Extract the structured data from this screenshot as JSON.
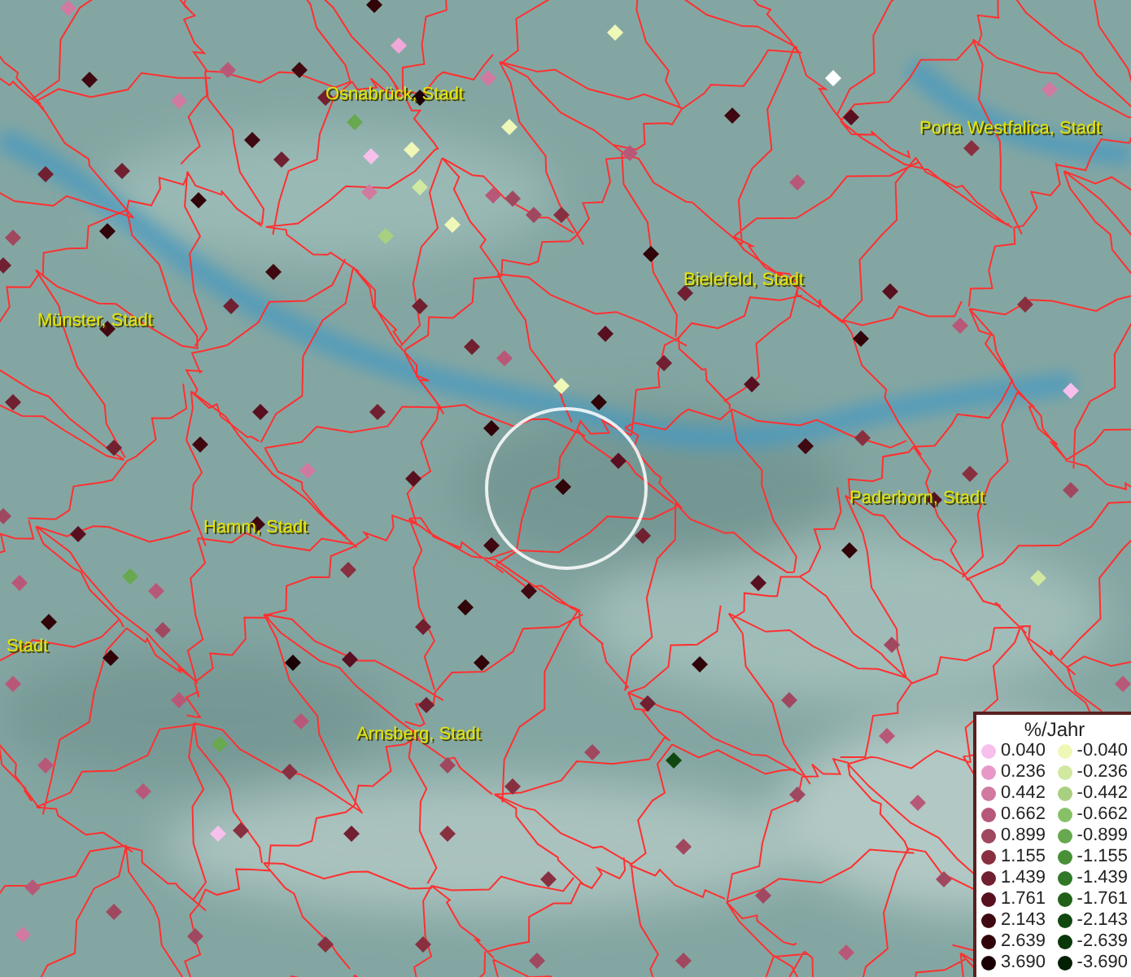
{
  "map": {
    "cities": [
      {
        "name": "Osnabrück, Stadt"
      },
      {
        "name": "Porta Westfalica, Stadt"
      },
      {
        "name": "Bielefeld, Stadt"
      },
      {
        "name": "Münster, Stadt"
      },
      {
        "name": "Paderborn, Stadt"
      },
      {
        "name": "Hamm, Stadt"
      },
      {
        "name": "Stadt"
      },
      {
        "name": "Arnsberg, Stadt"
      }
    ],
    "markers": [
      {
        "color": "#d07aa0"
      },
      {
        "color": "#300408"
      },
      {
        "color": "#f0f8b8"
      },
      {
        "color": "#f0a8d8"
      },
      {
        "color": "#ffffff"
      },
      {
        "color": "#400810"
      },
      {
        "color": "#b85878"
      },
      {
        "color": "#400810"
      },
      {
        "color": "#d07aa0"
      },
      {
        "color": "#d07aa0"
      },
      {
        "color": "#702030"
      },
      {
        "color": "#1a0004"
      },
      {
        "color": "#68a850"
      },
      {
        "color": "#f0f8b8"
      },
      {
        "color": "#400810"
      },
      {
        "color": "#f7c0ec"
      },
      {
        "color": "#f0f8b8"
      },
      {
        "color": "#702030"
      },
      {
        "color": "#b85878"
      },
      {
        "color": "#400810"
      },
      {
        "color": "#581020"
      },
      {
        "color": "#883040"
      },
      {
        "color": "#d07aa0"
      },
      {
        "color": "#702030"
      },
      {
        "color": "#702030"
      },
      {
        "color": "#300408"
      },
      {
        "color": "#d0e8a0"
      },
      {
        "color": "#d07aa0"
      },
      {
        "color": "#b85878"
      },
      {
        "color": "#f0f8b8"
      },
      {
        "color": "#a8d080"
      },
      {
        "color": "#a04860"
      },
      {
        "color": "#883040"
      },
      {
        "color": "#a04860"
      },
      {
        "color": "#a04860"
      },
      {
        "color": "#702030"
      },
      {
        "color": "#300408"
      },
      {
        "color": "#400810"
      },
      {
        "color": "#300408"
      },
      {
        "color": "#702030"
      },
      {
        "color": "#b85878"
      },
      {
        "color": "#581020"
      },
      {
        "color": "#300408"
      },
      {
        "color": "#400810"
      },
      {
        "color": "#702030"
      },
      {
        "color": "#702030"
      },
      {
        "color": "#702030"
      },
      {
        "color": "#581020"
      },
      {
        "color": "#b85878"
      },
      {
        "color": "#f0f8b8"
      },
      {
        "color": "#300408"
      },
      {
        "color": "#702030"
      },
      {
        "color": "#581020"
      },
      {
        "color": "#b85878"
      },
      {
        "color": "#f7c0ec"
      },
      {
        "color": "#883040"
      },
      {
        "color": "#702030"
      },
      {
        "color": "#702030"
      },
      {
        "color": "#400810"
      },
      {
        "color": "#581020"
      },
      {
        "color": "#d07aa0"
      },
      {
        "color": "#702030"
      },
      {
        "color": "#300408"
      },
      {
        "color": "#581020"
      },
      {
        "color": "#581020"
      },
      {
        "color": "#300408"
      },
      {
        "color": "#400810"
      },
      {
        "color": "#883040"
      },
      {
        "color": "#883040"
      },
      {
        "color": "#a04860"
      },
      {
        "color": "#581020"
      },
      {
        "color": "#a04860"
      },
      {
        "color": "#581020"
      },
      {
        "color": "#68a850"
      },
      {
        "color": "#b85878"
      },
      {
        "color": "#400810"
      },
      {
        "color": "#300408"
      },
      {
        "color": "#883040"
      },
      {
        "color": "#400810"
      },
      {
        "color": "#702030"
      },
      {
        "color": "#581020"
      },
      {
        "color": "#300408"
      },
      {
        "color": "#d0e8a0"
      },
      {
        "color": "#300408"
      },
      {
        "color": "#400810"
      },
      {
        "color": "#702030"
      },
      {
        "color": "#a04860"
      },
      {
        "color": "#300408"
      },
      {
        "color": "#1a0004"
      },
      {
        "color": "#581020"
      },
      {
        "color": "#300408"
      },
      {
        "color": "#300408"
      },
      {
        "color": "#a04860"
      },
      {
        "color": "#b85878"
      },
      {
        "color": "#b85878"
      },
      {
        "color": "#b85878"
      },
      {
        "color": "#68a850"
      },
      {
        "color": "#b85878"
      },
      {
        "color": "#702030"
      },
      {
        "color": "#702030"
      },
      {
        "color": "#a04860"
      },
      {
        "color": "#a04860"
      },
      {
        "color": "#104810"
      },
      {
        "color": "#b85878"
      },
      {
        "color": "#b85878"
      },
      {
        "color": "#b85878"
      },
      {
        "color": "#883040"
      },
      {
        "color": "#a04860"
      },
      {
        "color": "#883040"
      },
      {
        "color": "#a04860"
      },
      {
        "color": "#b85878"
      },
      {
        "color": "#883040"
      },
      {
        "color": "#702030"
      },
      {
        "color": "#883040"
      },
      {
        "color": "#f7c0ec"
      },
      {
        "color": "#883040"
      },
      {
        "color": "#a04860"
      },
      {
        "color": "#a04860"
      },
      {
        "color": "#b85878"
      },
      {
        "color": "#a04860"
      },
      {
        "color": "#a04860"
      },
      {
        "color": "#883040"
      },
      {
        "color": "#d07aa0"
      },
      {
        "color": "#883040"
      },
      {
        "color": "#a04860"
      },
      {
        "color": "#a04860"
      },
      {
        "color": "#b85878"
      },
      {
        "color": "#a04860"
      },
      {
        "color": "#b85878"
      }
    ]
  },
  "legend": {
    "title": "%/Jahr",
    "positive": [
      {
        "label": "0.040",
        "color": "#f7c0ec"
      },
      {
        "label": "0.236",
        "color": "#e898c8"
      },
      {
        "label": "0.442",
        "color": "#d07aa0"
      },
      {
        "label": "0.662",
        "color": "#b85878"
      },
      {
        "label": "0.899",
        "color": "#a04860"
      },
      {
        "label": "1.155",
        "color": "#883040"
      },
      {
        "label": "1.439",
        "color": "#702030"
      },
      {
        "label": "1.761",
        "color": "#581020"
      },
      {
        "label": "2.143",
        "color": "#400810"
      },
      {
        "label": "2.639",
        "color": "#300408"
      },
      {
        "label": "3.690",
        "color": "#1a0004"
      }
    ],
    "negative": [
      {
        "label": "-0.040",
        "color": "#f0f8b8"
      },
      {
        "label": "-0.236",
        "color": "#d0e8a0"
      },
      {
        "label": "-0.442",
        "color": "#a8d080"
      },
      {
        "label": "-0.662",
        "color": "#88c068"
      },
      {
        "label": "-0.899",
        "color": "#68a850"
      },
      {
        "label": "-1.155",
        "color": "#489038"
      },
      {
        "label": "-1.439",
        "color": "#307828"
      },
      {
        "label": "-1.761",
        "color": "#206018"
      },
      {
        "label": "-2.143",
        "color": "#104810"
      },
      {
        "label": "-2.639",
        "color": "#083808"
      },
      {
        "label": "-3.690",
        "color": "#042004"
      }
    ]
  }
}
